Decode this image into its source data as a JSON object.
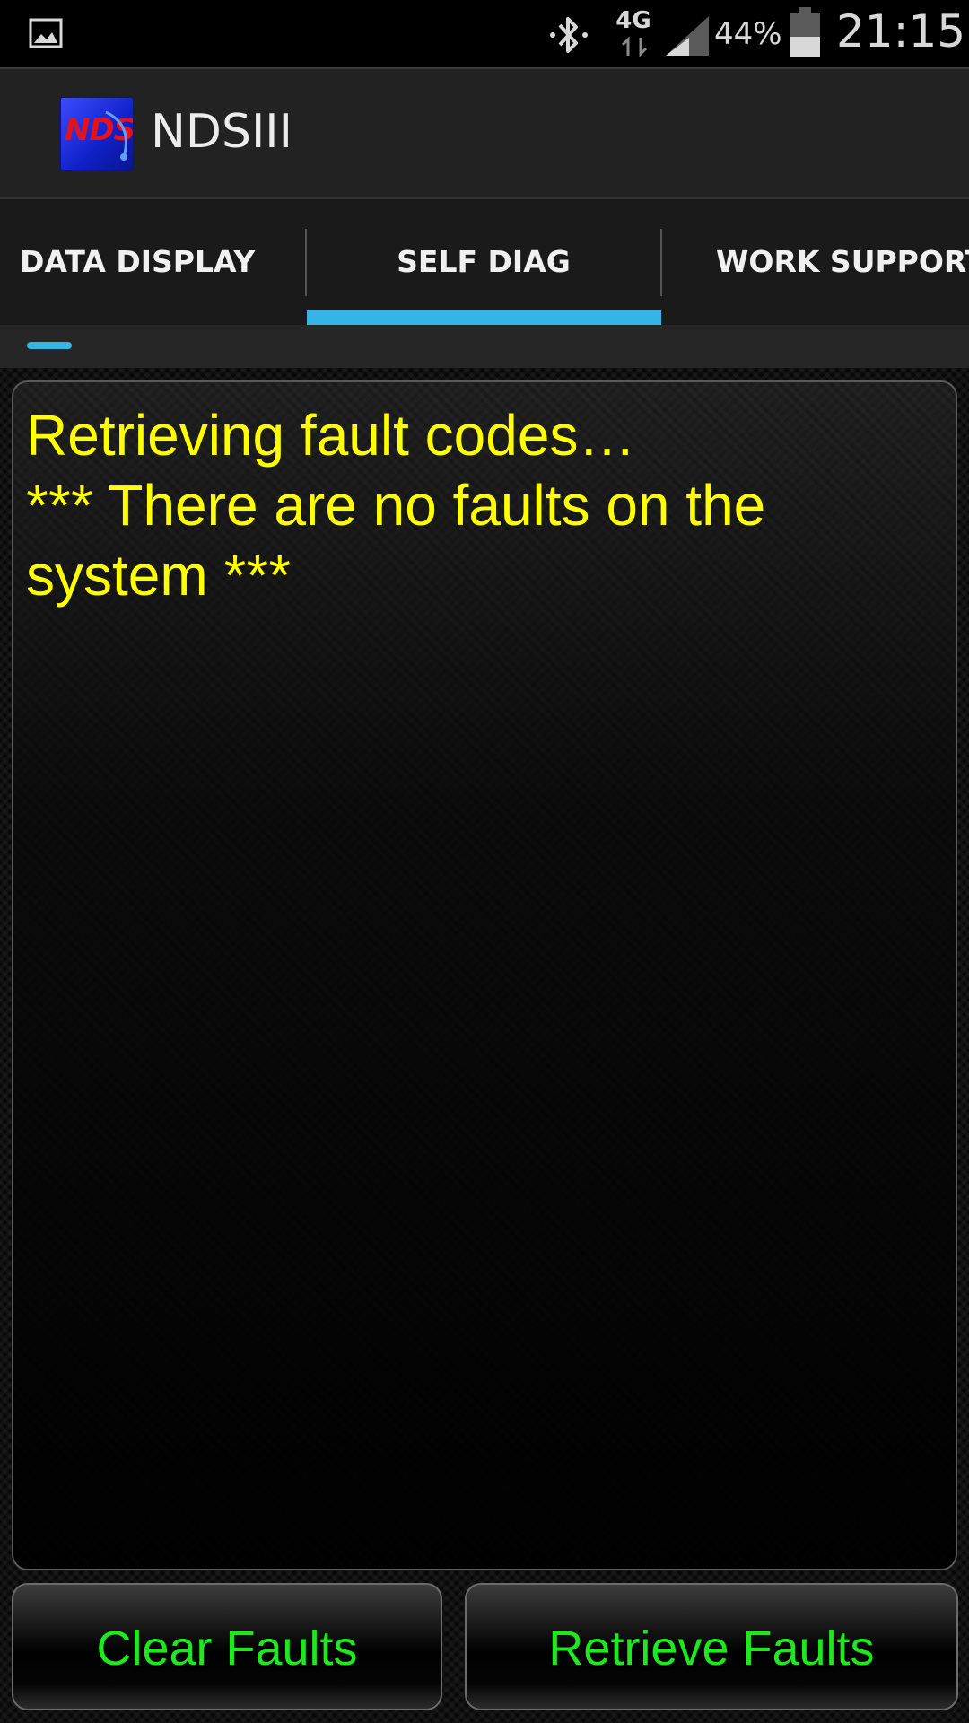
{
  "status_bar": {
    "notification_icon": "gallery-image-icon",
    "bluetooth_icon": "bluetooth-icon",
    "network_type": "4G",
    "signal_icon": "cell-signal-icon",
    "battery_percent": "44%",
    "battery_level": 0.44,
    "time": "21:15"
  },
  "action_bar": {
    "app_icon": "nds-logo-icon",
    "logo_text": "NDS",
    "title": "NDSIII"
  },
  "tabs": [
    {
      "label": "DATA DISPLAY",
      "selected": false
    },
    {
      "label": "SELF DIAG",
      "selected": true
    },
    {
      "label": "WORK SUPPORT",
      "selected": false
    }
  ],
  "colors": {
    "accent": "#33b5e5",
    "output_text": "#ffff00",
    "button_text": "#1ee81e"
  },
  "output": {
    "lines": [
      "Retrieving fault codes…",
      "*** There are no faults on the",
      "system ***"
    ]
  },
  "buttons": {
    "clear_label": "Clear Faults",
    "retrieve_label": "Retrieve Faults"
  }
}
